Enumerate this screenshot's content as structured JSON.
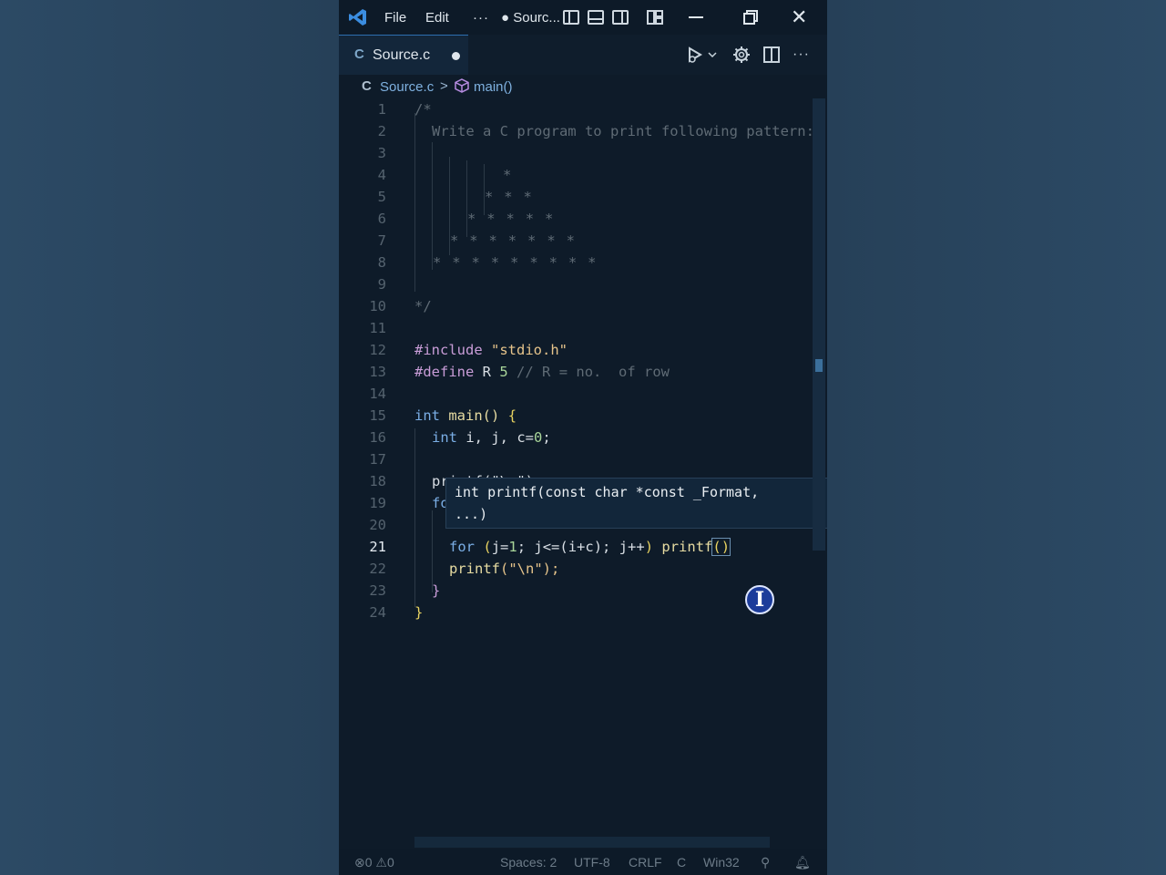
{
  "titlebar": {
    "menu": [
      "File",
      "Edit"
    ],
    "more": "···",
    "title": "● Sourc..."
  },
  "tab": {
    "lang_badge": "C",
    "name": "Source.c"
  },
  "breadcrumb": {
    "lang_badge": "C",
    "file": "Source.c",
    "separator": ">",
    "symbol": "main()"
  },
  "editor": {
    "active_line": 21,
    "line_numbers": [
      "1",
      "2",
      "3",
      "4",
      "5",
      "6",
      "7",
      "8",
      "9",
      "10",
      "11",
      "12",
      "13",
      "14",
      "15",
      "16",
      "17",
      "18",
      "19",
      "20",
      "21",
      "22",
      "23",
      "24"
    ],
    "comment": {
      "open": "/*",
      "description": "Write a C program to print following pattern:",
      "pattern": [
        "*",
        "* * *",
        "* * * * *",
        "* * * * * * *",
        "* * * * * * * * *"
      ],
      "close": "*/"
    },
    "include": {
      "directive": "#include",
      "file": "\"stdio.h\""
    },
    "define": {
      "directive": "#define",
      "name": "R",
      "value": "5",
      "comment": "// R = no.  of row"
    },
    "main_sig": {
      "type": "int",
      "name": "main()",
      "brace": "{"
    },
    "decl": {
      "type": "int",
      "vars": "i, j, c",
      "op": "=",
      "value": "0",
      "end": ";"
    },
    "line18": "printf(\"\\n\");",
    "line19": "fo",
    "line21": {
      "kw": "for",
      "open": "(",
      "init": "j=",
      "one": "1",
      "mid": "; j<=(i+c); j++",
      "close": ")",
      "call": "printf",
      "arg": "()"
    },
    "line22": {
      "call": "printf",
      "args": "(\"\\n\");"
    },
    "line23": "}",
    "line24": "}"
  },
  "tooltip": {
    "type": "int",
    "signature": "printf(const char *const _Format,",
    "continuation": "...)"
  },
  "statusbar": {
    "errors": "0",
    "warnings": "0",
    "spaces": "Spaces: 2",
    "encoding": "UTF-8",
    "eol": "CRLF",
    "language": "C",
    "platform": "Win32"
  },
  "colors": {
    "editor_bg": "#0e1b29",
    "background": "#2a4560",
    "accent": "#2d6fb0"
  },
  "icons": [
    "vscode-logo-icon",
    "layout-icons",
    "minimize-icon",
    "restore-icon",
    "close-icon",
    "run-icon",
    "gear-icon",
    "split-editor-icon",
    "more-actions-icon",
    "cube-icon",
    "text-cursor-icon",
    "error-icon",
    "warning-icon",
    "account-icon",
    "bell-icon"
  ]
}
